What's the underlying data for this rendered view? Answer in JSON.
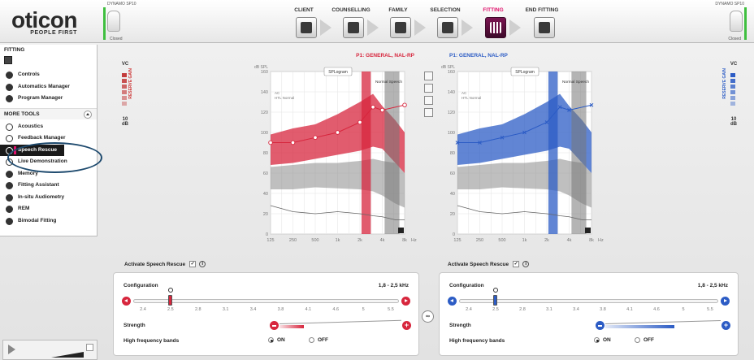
{
  "brand": {
    "name": "oticon",
    "tagline": "PEOPLE FIRST"
  },
  "devices": {
    "left": {
      "model": "DYNAMO SP10",
      "status": "Closed",
      "indicator_color": "#3fbf3f"
    },
    "right": {
      "model": "DYNAMO SP10",
      "status": "Closed",
      "indicator_color": "#3fbf3f"
    }
  },
  "workflow": {
    "steps": [
      {
        "label": "CLIENT",
        "icon": "client-icon",
        "active": false
      },
      {
        "label": "COUNSELLING",
        "icon": "counselling-icon",
        "active": false
      },
      {
        "label": "FAMILY",
        "icon": "family-icon",
        "active": false
      },
      {
        "label": "SELECTION",
        "icon": "selection-icon",
        "active": false
      },
      {
        "label": "FITTING",
        "icon": "fitting-icon",
        "active": true
      },
      {
        "label": "END FITTING",
        "icon": "end-fitting-icon",
        "active": false
      }
    ],
    "active_color": "#e0106a"
  },
  "sidebar": {
    "section": "FITTING",
    "section_badge": "P1",
    "items": [
      {
        "label": "Controls",
        "icon": "controls-icon"
      },
      {
        "label": "Automatics Manager",
        "icon": "automatics-icon"
      },
      {
        "label": "Program Manager",
        "icon": "program-icon"
      }
    ],
    "more_tools_label": "MORE TOOLS",
    "tools": [
      {
        "label": "Acoustics",
        "icon": "acoustics-icon"
      },
      {
        "label": "Feedback Manager",
        "icon": "feedback-icon"
      },
      {
        "label": "Speech Rescue",
        "icon": "speech-rescue-icon",
        "selected": true
      },
      {
        "label": "Live Demonstration",
        "icon": "live-demo-icon"
      },
      {
        "label": "Memory",
        "icon": "memory-icon"
      },
      {
        "label": "Fitting Assistant",
        "icon": "fitting-assistant-icon"
      },
      {
        "label": "In-situ Audiometry",
        "icon": "audiometry-icon"
      },
      {
        "label": "REM",
        "icon": "rem-icon"
      },
      {
        "label": "Bimodal Fitting",
        "icon": "bimodal-icon"
      }
    ]
  },
  "vc": {
    "left": {
      "label": "VC",
      "reserve": "RESERVE GAIN",
      "value": "10 dB",
      "color": "#c33b3b"
    },
    "right": {
      "label": "VC",
      "reserve": "RESERVE GAIN",
      "value": "10 dB",
      "color": "#2c5cc5"
    }
  },
  "chart_data": [
    {
      "type": "line",
      "side": "left",
      "title": "P1: GENERAL, NAL-RP",
      "toggle_label": "SPLogram",
      "ylabel": "dB SPL",
      "xunit": "Hz",
      "ylim": [
        0,
        160
      ],
      "y_ticks": [
        0,
        20,
        40,
        60,
        80,
        100,
        120,
        140,
        160
      ],
      "x_ticks": [
        "125",
        "250",
        "500",
        "1k",
        "2k",
        "4k",
        "8k"
      ],
      "legend": [
        "AC",
        "HTL Normal"
      ],
      "annotation": "Normal Speech",
      "color": "#d7263d",
      "threshold": {
        "marker": "circle",
        "x": [
          125,
          250,
          500,
          1000,
          2000,
          3000,
          4000,
          8000
        ],
        "y": [
          90,
          90,
          95,
          100,
          110,
          125,
          122,
          127
        ]
      },
      "speech_band_hz": [
        2100,
        2800
      ],
      "normal_speech_hz": [
        4300,
        6800
      ]
    },
    {
      "type": "line",
      "side": "right",
      "title": "P1: GENERAL, NAL-RP",
      "toggle_label": "SPLogram",
      "ylabel": "dB SPL",
      "xunit": "Hz",
      "ylim": [
        0,
        160
      ],
      "y_ticks": [
        0,
        20,
        40,
        60,
        80,
        100,
        120,
        140,
        160
      ],
      "x_ticks": [
        "125",
        "250",
        "500",
        "1k",
        "2k",
        "4k",
        "8k"
      ],
      "legend": [
        "AC",
        "HTL Normal"
      ],
      "annotation": "Normal Speech",
      "color": "#2c5cc5",
      "threshold": {
        "marker": "cross",
        "x": [
          125,
          250,
          500,
          1000,
          2000,
          3000,
          4000,
          8000
        ],
        "y": [
          90,
          90,
          95,
          100,
          110,
          125,
          122,
          127
        ]
      },
      "speech_band_hz": [
        2100,
        2800
      ],
      "normal_speech_hz": [
        4300,
        6800
      ]
    }
  ],
  "speech_rescue": {
    "activate_label": "Activate Speech Rescue",
    "activated": true,
    "left": {
      "config_label": "Configuration",
      "range": "1,8 - 2,5 kHz",
      "ticks": [
        "2.4",
        "2.5",
        "2.8",
        "3.1",
        "3.4",
        "3.8",
        "4.1",
        "4.6",
        "5",
        "5.5"
      ],
      "selected_tick": 1,
      "strength_label": "Strength",
      "strength": 0.2,
      "hf_label": "High frequency bands",
      "on_label": "ON",
      "off_label": "OFF",
      "hf_on": true,
      "color": "#d7263d"
    },
    "right": {
      "config_label": "Configuration",
      "range": "1,8 - 2,5 kHz",
      "ticks": [
        "2.4",
        "2.5",
        "2.8",
        "3.1",
        "3.4",
        "3.8",
        "4.1",
        "4.6",
        "5",
        "5.5"
      ],
      "selected_tick": 1,
      "strength_label": "Strength",
      "strength": 0.6,
      "hf_label": "High frequency bands",
      "on_label": "ON",
      "off_label": "OFF",
      "hf_on": true,
      "color": "#2c5cc5"
    }
  }
}
